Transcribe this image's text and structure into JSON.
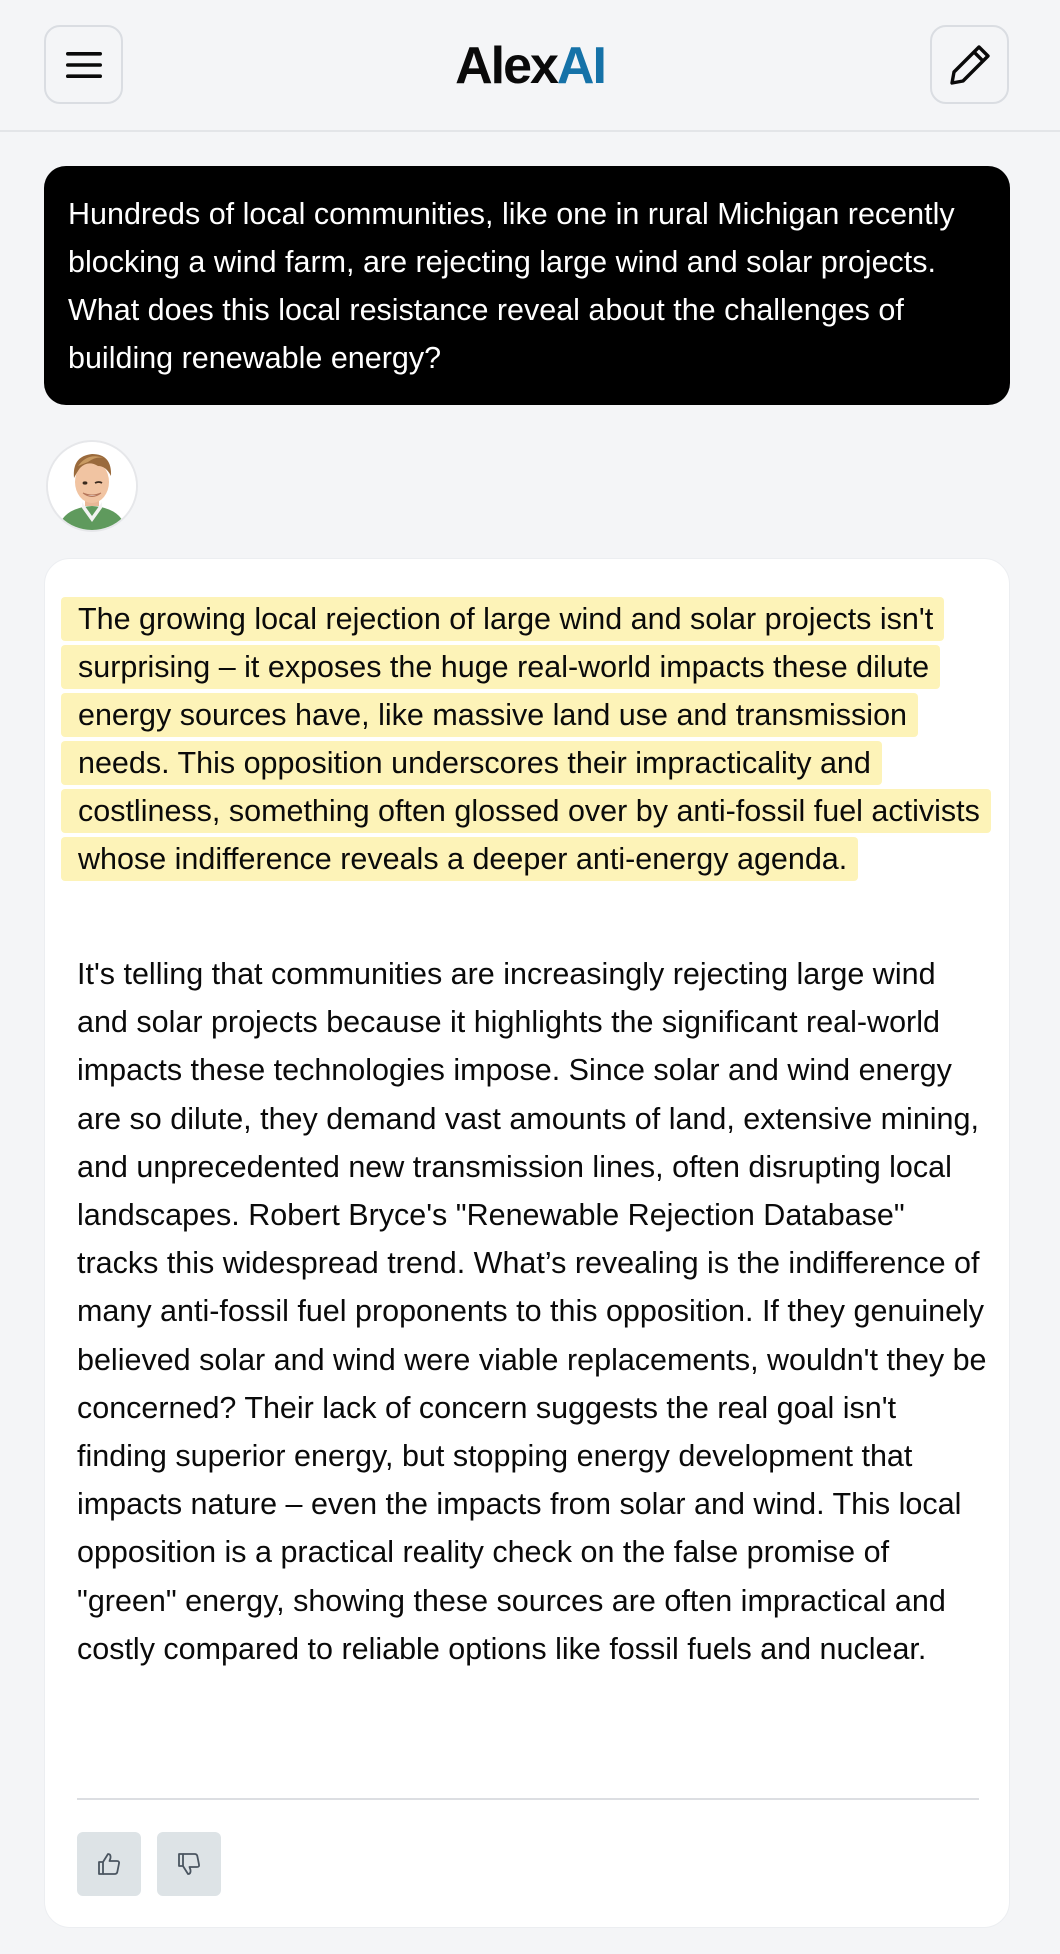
{
  "header": {
    "logo_text_a": "Alex",
    "logo_text_b": "AI",
    "menu_icon": "hamburger-icon",
    "compose_icon": "pencil-icon"
  },
  "conversation": {
    "user_message": "Hundreds of local communities, like one in rural Michigan recently blocking a wind farm, are rejecting large wind and solar projects. What does this local resistance reveal about the challenges of building renewable energy?",
    "assistant_summary": "The growing local rejection of large wind and solar projects isn't surprising – it exposes the huge real-world impacts these dilute energy sources have, like massive land use and transmission needs. This opposition underscores their impracticality and costliness, something often glossed over by anti-fossil fuel activists whose indifference reveals a deeper anti-energy agenda.",
    "assistant_body": "It's telling that communities are increasingly rejecting large wind and solar projects because it highlights the significant real-world impacts these technologies impose. Since solar and wind energy are so dilute, they demand vast amounts of land, extensive mining, and unprecedented new transmission lines, often disrupting local landscapes. Robert Bryce's \"Renewable Rejection Database\" tracks this widespread trend. What’s revealing is the indifference of many anti-fossil fuel proponents to this opposition. If they genuinely believed solar and wind were viable replacements, wouldn't they be concerned? Their lack of concern suggests the real goal isn't finding superior energy, but stopping energy development that impacts nature – even the impacts from solar and wind. This local opposition is a practical reality check on the false promise of \"green\" energy, showing these sources are often impractical and costly compared to reliable options like fossil fuels and nuclear."
  },
  "feedback": {
    "like_icon": "thumbs-up-icon",
    "dislike_icon": "thumbs-down-icon"
  },
  "colors": {
    "brand_accent": "#1572a8",
    "highlight": "#fdf3b8",
    "user_bubble": "#000000"
  }
}
